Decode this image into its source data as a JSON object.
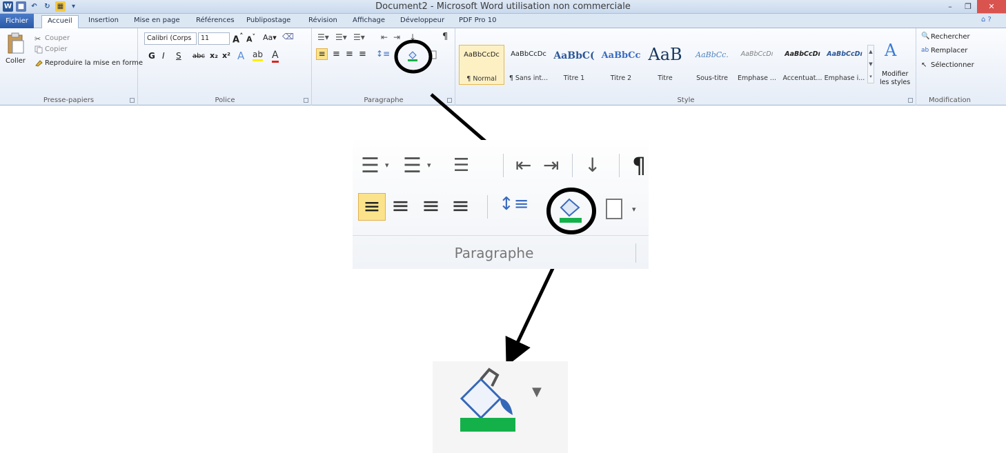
{
  "window": {
    "title": "Document2 - Microsoft Word utilisation non commerciale",
    "minimize": "–",
    "restore": "❐",
    "close": "✕"
  },
  "tabs": {
    "file": "Fichier",
    "accueil": "Accueil",
    "insertion": "Insertion",
    "mise_en_page": "Mise en page",
    "references": "Références",
    "publipostage": "Publipostage",
    "revision": "Révision",
    "affichage": "Affichage",
    "developpeur": "Développeur",
    "pdf": "PDF Pro 10"
  },
  "clipboard": {
    "paste": "Coller",
    "cut": "Couper",
    "copy": "Copier",
    "format_painter": "Reproduire la mise en forme",
    "label": "Presse-papiers"
  },
  "font": {
    "family": "Calibri (Corps",
    "size": "11",
    "label": "Police",
    "bold": "G",
    "italic": "I",
    "underline": "S",
    "strike": "abc"
  },
  "paragraph": {
    "label": "Paragraphe",
    "zoom_label": "Paragraphe"
  },
  "styles": {
    "label": "Style",
    "items": [
      {
        "preview": "AaBbCcDc",
        "name": "¶ Normal"
      },
      {
        "preview": "AaBbCcDc",
        "name": "¶ Sans int..."
      },
      {
        "preview": "AaBbC(",
        "name": "Titre 1"
      },
      {
        "preview": "AaBbCc",
        "name": "Titre 2"
      },
      {
        "preview": "AaB",
        "name": "Titre"
      },
      {
        "preview": "AaBbCc.",
        "name": "Sous-titre"
      },
      {
        "preview": "AaBbCcDı",
        "name": "Emphase ..."
      },
      {
        "preview": "AaBbCcDı",
        "name": "Accentuat..."
      },
      {
        "preview": "AaBbCcDı",
        "name": "Emphase i..."
      }
    ],
    "modify": "Modifier",
    "modify2": "les styles"
  },
  "editing": {
    "find": "Rechercher",
    "replace": "Remplacer",
    "select": "Sélectionner",
    "label": "Modification"
  },
  "colors": {
    "shading_bar": "#14b14a",
    "highlight_active": "#fbe38c",
    "file_tab": "#2f5fae"
  }
}
